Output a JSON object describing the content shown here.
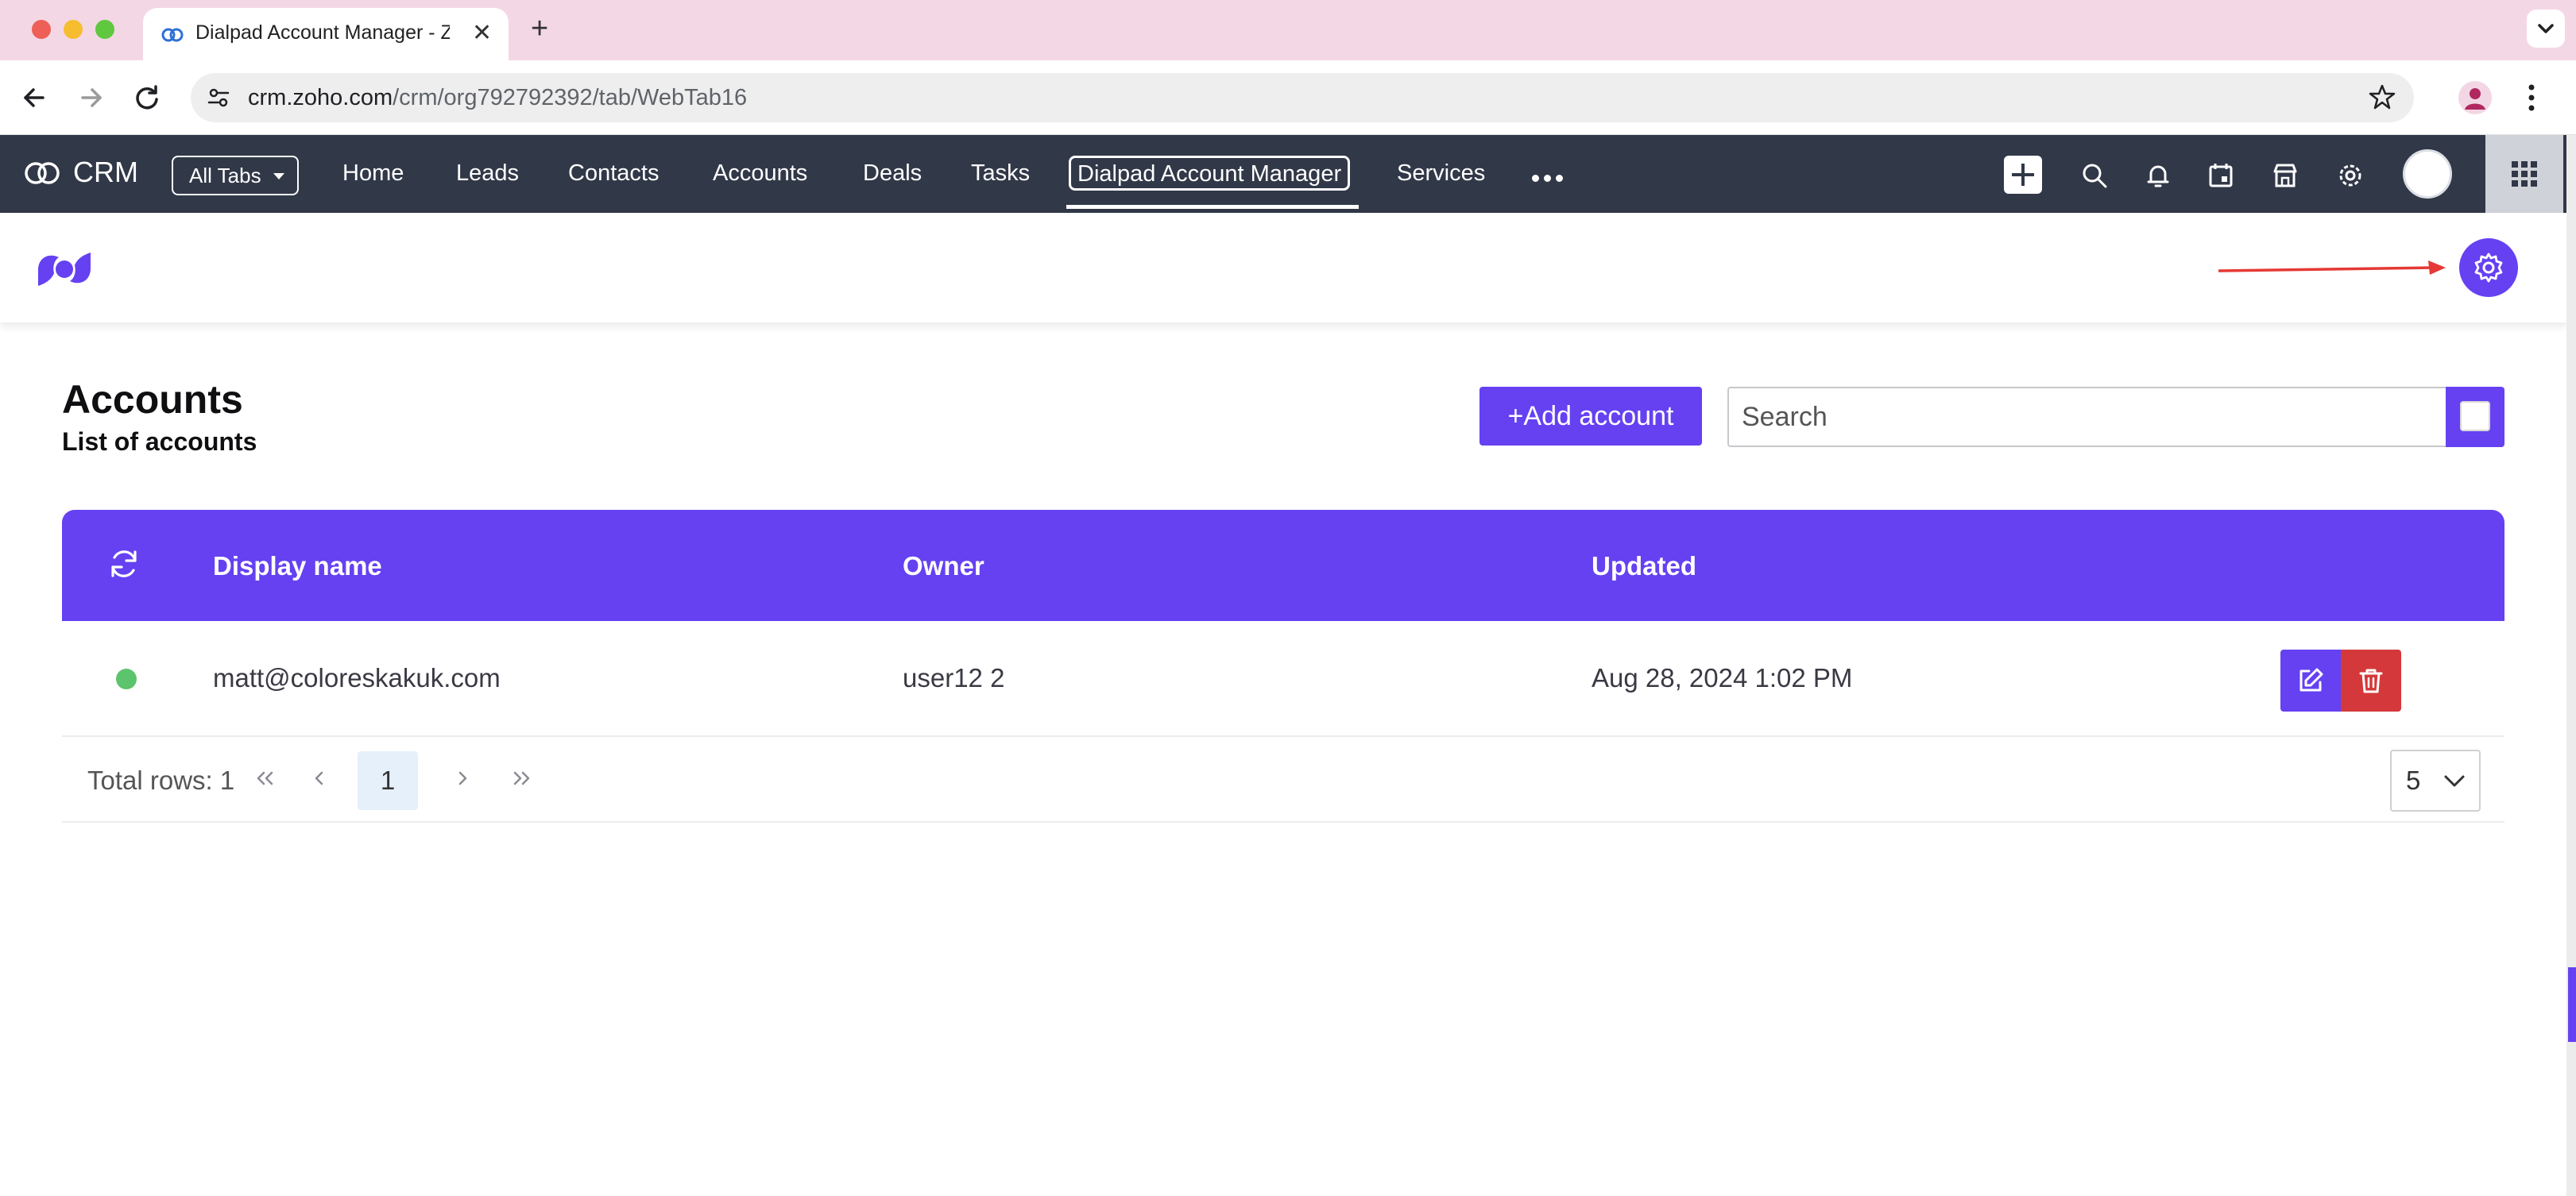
{
  "browser": {
    "tab_title": "Dialpad Account Manager - Zoho CRM",
    "url_host": "crm.zoho.com",
    "url_path": "/crm/org792792392/tab/WebTab16"
  },
  "crm_nav": {
    "app_name": "CRM",
    "all_tabs_label": "All Tabs",
    "items": [
      {
        "label": "Home"
      },
      {
        "label": "Leads"
      },
      {
        "label": "Contacts"
      },
      {
        "label": "Accounts"
      },
      {
        "label": "Deals"
      },
      {
        "label": "Tasks"
      },
      {
        "label": "Dialpad Account Manager",
        "active": true
      },
      {
        "label": "Services"
      }
    ]
  },
  "page": {
    "title": "Accounts",
    "subtitle": "List of accounts",
    "add_button_label": "+Add account",
    "search_placeholder": "Search"
  },
  "table": {
    "columns": [
      "Display name",
      "Owner",
      "Updated"
    ],
    "rows": [
      {
        "status": "active",
        "display_name": "matt@coloreskakuk.com",
        "owner": "user12 2",
        "updated": "Aug 28, 2024 1:02 PM"
      }
    ]
  },
  "pagination": {
    "total_label": "Total rows: 1",
    "current_page": "1",
    "page_size": "5"
  },
  "colors": {
    "accent": "#6541f2",
    "nav_bg": "#313848",
    "danger": "#d4383a",
    "status_active": "#5cc46c",
    "annotation": "#e53935"
  },
  "icons": {
    "tab_favicon": "zoho-crm-icon",
    "settings": "gear-icon",
    "refresh": "refresh-icon",
    "edit": "edit-icon",
    "delete": "trash-icon"
  }
}
